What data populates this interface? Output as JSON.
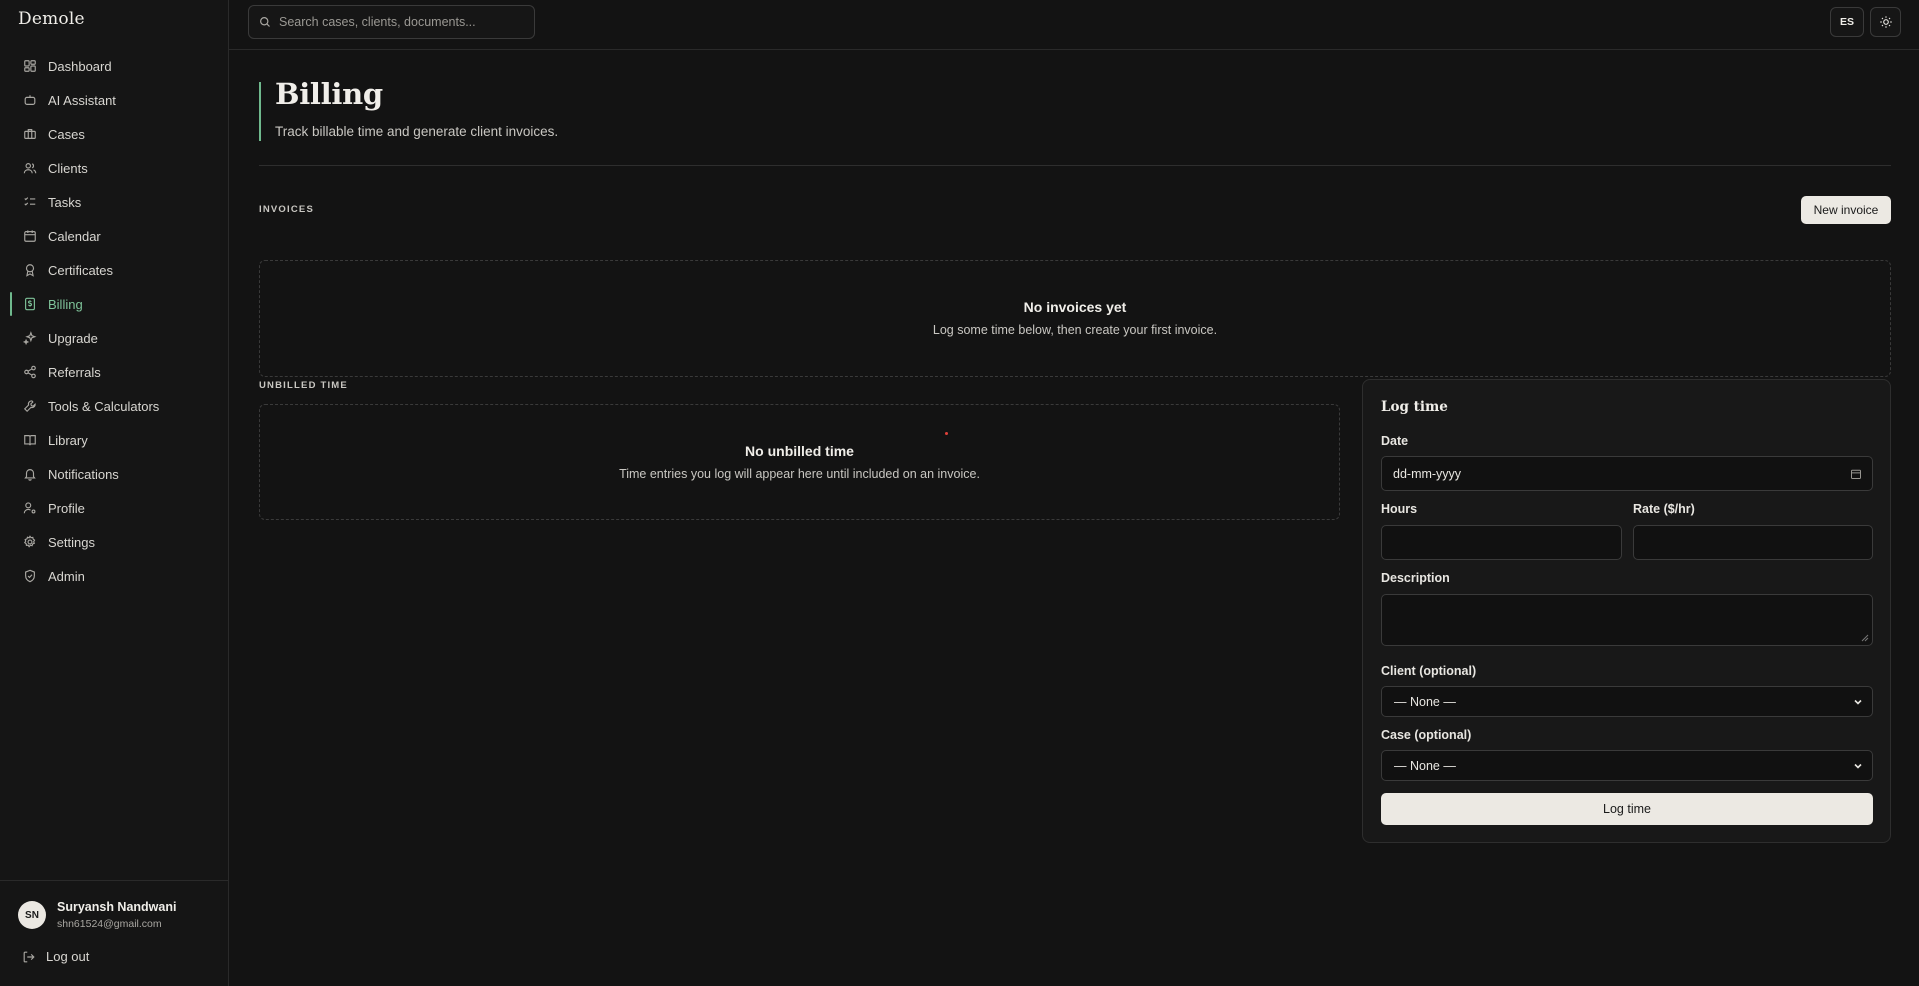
{
  "app": {
    "brand": "Demole"
  },
  "sidebar": {
    "items": [
      {
        "label": "Dashboard",
        "icon": "dashboard-icon"
      },
      {
        "label": "AI Assistant",
        "icon": "bot-icon"
      },
      {
        "label": "Cases",
        "icon": "briefcase-icon"
      },
      {
        "label": "Clients",
        "icon": "users-icon"
      },
      {
        "label": "Tasks",
        "icon": "checklist-icon"
      },
      {
        "label": "Calendar",
        "icon": "calendar-icon"
      },
      {
        "label": "Certificates",
        "icon": "award-icon"
      },
      {
        "label": "Billing",
        "icon": "billing-icon",
        "active": true
      },
      {
        "label": "Upgrade",
        "icon": "sparkles-icon"
      },
      {
        "label": "Referrals",
        "icon": "share-icon"
      },
      {
        "label": "Tools & Calculators",
        "icon": "wrench-icon"
      },
      {
        "label": "Library",
        "icon": "book-icon"
      },
      {
        "label": "Notifications",
        "icon": "bell-icon"
      },
      {
        "label": "Profile",
        "icon": "user-cog-icon"
      },
      {
        "label": "Settings",
        "icon": "gear-icon"
      },
      {
        "label": "Admin",
        "icon": "shield-icon"
      }
    ],
    "user": {
      "initials": "SN",
      "name": "Suryansh Nandwani",
      "email": "shn61524@gmail.com"
    },
    "logout_label": "Log out"
  },
  "topbar": {
    "search_placeholder": "Search cases, clients, documents...",
    "language": "ES"
  },
  "page": {
    "title": "Billing",
    "subtitle": "Track billable time and generate client invoices."
  },
  "invoices": {
    "section_label": "INVOICES",
    "new_button": "New invoice",
    "empty_title": "No invoices yet",
    "empty_text": "Log some time below, then create your first invoice."
  },
  "unbilled": {
    "section_label": "UNBILLED TIME",
    "empty_title": "No unbilled time",
    "empty_text": "Time entries you log will appear here until included on an invoice."
  },
  "log_time": {
    "title": "Log time",
    "date_label": "Date",
    "date_placeholder": "dd-mm-yyyy",
    "hours_label": "Hours",
    "rate_label": "Rate ($/hr)",
    "description_label": "Description",
    "client_label": "Client (optional)",
    "client_value": "— None —",
    "case_label": "Case (optional)",
    "case_value": "— None —",
    "submit_label": "Log time"
  },
  "colors": {
    "background": "#131313",
    "accent": "#6fb98d",
    "button_light": "#ece9e3"
  }
}
